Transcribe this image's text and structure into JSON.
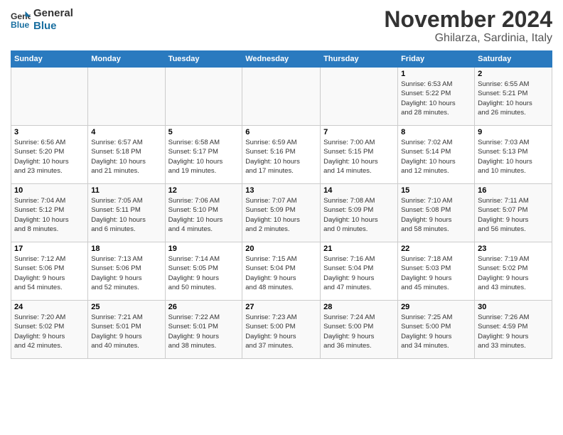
{
  "logo": {
    "line1": "General",
    "line2": "Blue"
  },
  "title": "November 2024",
  "location": "Ghilarza, Sardinia, Italy",
  "headers": [
    "Sunday",
    "Monday",
    "Tuesday",
    "Wednesday",
    "Thursday",
    "Friday",
    "Saturday"
  ],
  "rows": [
    [
      {
        "day": "",
        "info": ""
      },
      {
        "day": "",
        "info": ""
      },
      {
        "day": "",
        "info": ""
      },
      {
        "day": "",
        "info": ""
      },
      {
        "day": "",
        "info": ""
      },
      {
        "day": "1",
        "info": "Sunrise: 6:53 AM\nSunset: 5:22 PM\nDaylight: 10 hours\nand 28 minutes."
      },
      {
        "day": "2",
        "info": "Sunrise: 6:55 AM\nSunset: 5:21 PM\nDaylight: 10 hours\nand 26 minutes."
      }
    ],
    [
      {
        "day": "3",
        "info": "Sunrise: 6:56 AM\nSunset: 5:20 PM\nDaylight: 10 hours\nand 23 minutes."
      },
      {
        "day": "4",
        "info": "Sunrise: 6:57 AM\nSunset: 5:18 PM\nDaylight: 10 hours\nand 21 minutes."
      },
      {
        "day": "5",
        "info": "Sunrise: 6:58 AM\nSunset: 5:17 PM\nDaylight: 10 hours\nand 19 minutes."
      },
      {
        "day": "6",
        "info": "Sunrise: 6:59 AM\nSunset: 5:16 PM\nDaylight: 10 hours\nand 17 minutes."
      },
      {
        "day": "7",
        "info": "Sunrise: 7:00 AM\nSunset: 5:15 PM\nDaylight: 10 hours\nand 14 minutes."
      },
      {
        "day": "8",
        "info": "Sunrise: 7:02 AM\nSunset: 5:14 PM\nDaylight: 10 hours\nand 12 minutes."
      },
      {
        "day": "9",
        "info": "Sunrise: 7:03 AM\nSunset: 5:13 PM\nDaylight: 10 hours\nand 10 minutes."
      }
    ],
    [
      {
        "day": "10",
        "info": "Sunrise: 7:04 AM\nSunset: 5:12 PM\nDaylight: 10 hours\nand 8 minutes."
      },
      {
        "day": "11",
        "info": "Sunrise: 7:05 AM\nSunset: 5:11 PM\nDaylight: 10 hours\nand 6 minutes."
      },
      {
        "day": "12",
        "info": "Sunrise: 7:06 AM\nSunset: 5:10 PM\nDaylight: 10 hours\nand 4 minutes."
      },
      {
        "day": "13",
        "info": "Sunrise: 7:07 AM\nSunset: 5:09 PM\nDaylight: 10 hours\nand 2 minutes."
      },
      {
        "day": "14",
        "info": "Sunrise: 7:08 AM\nSunset: 5:09 PM\nDaylight: 10 hours\nand 0 minutes."
      },
      {
        "day": "15",
        "info": "Sunrise: 7:10 AM\nSunset: 5:08 PM\nDaylight: 9 hours\nand 58 minutes."
      },
      {
        "day": "16",
        "info": "Sunrise: 7:11 AM\nSunset: 5:07 PM\nDaylight: 9 hours\nand 56 minutes."
      }
    ],
    [
      {
        "day": "17",
        "info": "Sunrise: 7:12 AM\nSunset: 5:06 PM\nDaylight: 9 hours\nand 54 minutes."
      },
      {
        "day": "18",
        "info": "Sunrise: 7:13 AM\nSunset: 5:06 PM\nDaylight: 9 hours\nand 52 minutes."
      },
      {
        "day": "19",
        "info": "Sunrise: 7:14 AM\nSunset: 5:05 PM\nDaylight: 9 hours\nand 50 minutes."
      },
      {
        "day": "20",
        "info": "Sunrise: 7:15 AM\nSunset: 5:04 PM\nDaylight: 9 hours\nand 48 minutes."
      },
      {
        "day": "21",
        "info": "Sunrise: 7:16 AM\nSunset: 5:04 PM\nDaylight: 9 hours\nand 47 minutes."
      },
      {
        "day": "22",
        "info": "Sunrise: 7:18 AM\nSunset: 5:03 PM\nDaylight: 9 hours\nand 45 minutes."
      },
      {
        "day": "23",
        "info": "Sunrise: 7:19 AM\nSunset: 5:02 PM\nDaylight: 9 hours\nand 43 minutes."
      }
    ],
    [
      {
        "day": "24",
        "info": "Sunrise: 7:20 AM\nSunset: 5:02 PM\nDaylight: 9 hours\nand 42 minutes."
      },
      {
        "day": "25",
        "info": "Sunrise: 7:21 AM\nSunset: 5:01 PM\nDaylight: 9 hours\nand 40 minutes."
      },
      {
        "day": "26",
        "info": "Sunrise: 7:22 AM\nSunset: 5:01 PM\nDaylight: 9 hours\nand 38 minutes."
      },
      {
        "day": "27",
        "info": "Sunrise: 7:23 AM\nSunset: 5:00 PM\nDaylight: 9 hours\nand 37 minutes."
      },
      {
        "day": "28",
        "info": "Sunrise: 7:24 AM\nSunset: 5:00 PM\nDaylight: 9 hours\nand 36 minutes."
      },
      {
        "day": "29",
        "info": "Sunrise: 7:25 AM\nSunset: 5:00 PM\nDaylight: 9 hours\nand 34 minutes."
      },
      {
        "day": "30",
        "info": "Sunrise: 7:26 AM\nSunset: 4:59 PM\nDaylight: 9 hours\nand 33 minutes."
      }
    ]
  ]
}
